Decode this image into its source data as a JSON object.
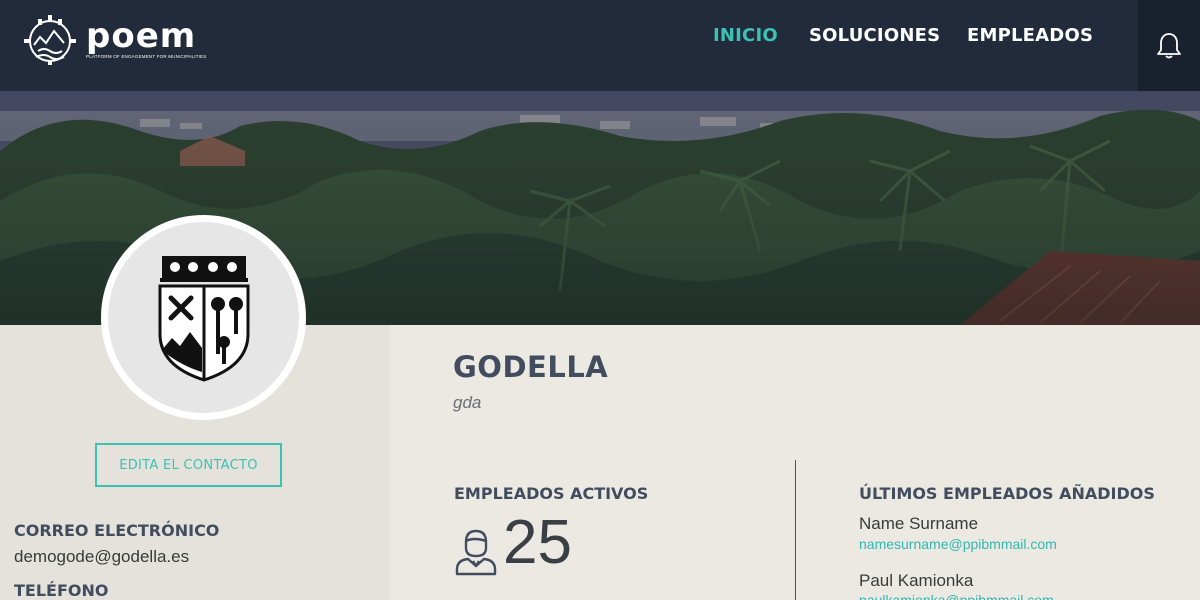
{
  "brand": {
    "name": "poem",
    "tagline": "PLATFORM OF ENGAGEMENT FOR MUNICIPALITIES",
    "accent": "#3cc1b4",
    "navbar_bg": "#212b3b"
  },
  "nav": {
    "items": [
      {
        "label": "INICIO",
        "active": true
      },
      {
        "label": "SOLUCIONES",
        "active": false
      },
      {
        "label": "EMPLEADOS",
        "active": false
      }
    ],
    "notifications_icon": "bell-icon"
  },
  "profile": {
    "emblem_icon": "municipal-coat-of-arms",
    "edit_label": "EDITA EL CONTACTO",
    "email_label": "CORREO ELECTRÓNICO",
    "email_value": "demogode@godella.es",
    "phone_label": "TELÉFONO"
  },
  "org": {
    "name": "GODELLA",
    "code": "gda"
  },
  "stats": {
    "active_label": "EMPLEADOS ACTIVOS",
    "active_count": "25",
    "employee_icon": "employee-icon"
  },
  "recent": {
    "title": "ÚLTIMOS EMPLEADOS AÑADIDOS",
    "employees": [
      {
        "name": "Name Surname",
        "email": "namesurname@ppibmmail.com"
      },
      {
        "name": "Paul Kamionka",
        "email": "paulkamionka@ppibmmail.com"
      }
    ]
  }
}
